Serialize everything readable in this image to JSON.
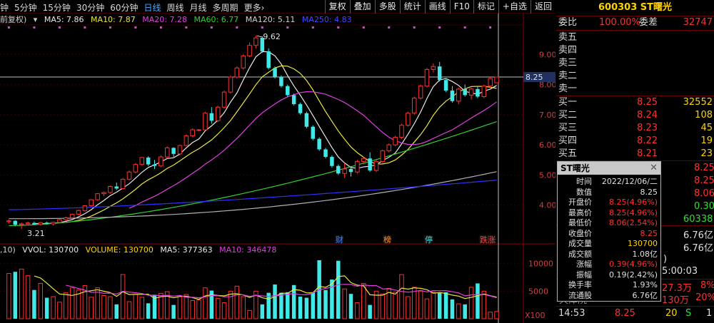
{
  "tabs": [
    "钟",
    "5分钟",
    "15分钟",
    "30分钟",
    "60分钟",
    "日线",
    "周线",
    "月线",
    "多周期",
    "更多›"
  ],
  "active_tab": 5,
  "toolbar": [
    "复权",
    "叠加",
    "多股",
    "统计",
    "画线",
    "F10",
    "标记",
    "+自选",
    "返回"
  ],
  "indicators": {
    "fq": "前复权)",
    "ma5": "MA5: 7.86",
    "ma10": "MA10: 7.87",
    "ma20": "MA20: 7.28",
    "ma60": "MA60: 6.77",
    "ma120": "MA120: 5.11",
    "ma250": "MA250: 4.83"
  },
  "vol_indicators": {
    "prefix": ",10)",
    "vvol": "VVOL: 130700",
    "volume": "VOLUME: 130700",
    "ma5": "MA5: 377363",
    "ma10": "MA10: 346478"
  },
  "price_axis": [
    "9.00",
    "8.00",
    "7.00",
    "6.00",
    "5.00",
    "4.00"
  ],
  "price_axis_values": [
    9,
    8,
    7,
    6,
    5,
    4
  ],
  "current_price_tag": "8.25",
  "current_price_value": 8.25,
  "high_label": "9.62",
  "high_value": 9.62,
  "low_label": "3.21",
  "low_value": 3.21,
  "volume_axis": [
    "10000",
    "5000"
  ],
  "volume_axis_values": [
    10000,
    5000
  ],
  "volume_unit": "X100",
  "markers": [
    "财",
    "榜",
    "停",
    "跌涨"
  ],
  "colors": {
    "up": "#ff3030",
    "down": "#40e8e8",
    "ma5": "#e8e8e8",
    "ma10": "#e8e840",
    "ma20": "#e040e0",
    "ma60": "#30d030",
    "ma120": "#b0b0b0",
    "ma250": "#3030ff",
    "highlight": "#ffd400"
  },
  "chart_data": {
    "type": "candlestick",
    "ohlc": [
      [
        3.45,
        3.52,
        3.4,
        3.48
      ],
      [
        3.48,
        3.5,
        3.3,
        3.35
      ],
      [
        3.35,
        3.42,
        3.21,
        3.38
      ],
      [
        3.38,
        3.45,
        3.32,
        3.41
      ],
      [
        3.41,
        3.45,
        3.34,
        3.36
      ],
      [
        3.36,
        3.44,
        3.32,
        3.42
      ],
      [
        3.42,
        3.45,
        3.35,
        3.38
      ],
      [
        3.38,
        3.45,
        3.33,
        3.43
      ],
      [
        3.43,
        3.55,
        3.4,
        3.52
      ],
      [
        3.52,
        3.62,
        3.48,
        3.58
      ],
      [
        3.58,
        3.72,
        3.55,
        3.7
      ],
      [
        3.7,
        3.85,
        3.66,
        3.82
      ],
      [
        3.82,
        4.0,
        3.78,
        3.98
      ],
      [
        3.98,
        4.2,
        3.95,
        4.18
      ],
      [
        4.18,
        4.4,
        4.15,
        4.38
      ],
      [
        4.38,
        4.45,
        4.3,
        4.42
      ],
      [
        4.42,
        4.65,
        4.38,
        4.62
      ],
      [
        4.62,
        4.75,
        4.5,
        4.55
      ],
      [
        4.55,
        4.9,
        4.52,
        4.86
      ],
      [
        4.86,
        5.15,
        4.82,
        5.1
      ],
      [
        5.1,
        5.4,
        5.05,
        5.35
      ],
      [
        5.35,
        5.6,
        5.3,
        5.58
      ],
      [
        5.58,
        5.62,
        5.3,
        5.35
      ],
      [
        5.35,
        5.5,
        5.2,
        5.3
      ],
      [
        5.3,
        5.65,
        5.25,
        5.6
      ],
      [
        5.6,
        5.95,
        5.55,
        5.9
      ],
      [
        5.9,
        5.92,
        5.6,
        5.7
      ],
      [
        5.7,
        6.0,
        5.65,
        5.98
      ],
      [
        5.98,
        6.35,
        5.95,
        6.3
      ],
      [
        6.3,
        6.55,
        6.25,
        6.5
      ],
      [
        6.5,
        6.52,
        6.45,
        6.5
      ],
      [
        6.5,
        7.1,
        6.48,
        7.05
      ],
      [
        7.05,
        7.25,
        6.7,
        6.8
      ],
      [
        6.8,
        7.3,
        6.75,
        7.25
      ],
      [
        7.25,
        7.8,
        7.2,
        7.75
      ],
      [
        7.75,
        8.3,
        7.7,
        8.25
      ],
      [
        8.25,
        8.6,
        8.2,
        8.55
      ],
      [
        8.55,
        9.0,
        8.5,
        8.95
      ],
      [
        8.95,
        9.4,
        8.9,
        9.3
      ],
      [
        9.3,
        9.62,
        9.2,
        9.55
      ],
      [
        9.55,
        9.6,
        9.05,
        9.1
      ],
      [
        9.1,
        9.2,
        8.5,
        8.55
      ],
      [
        8.55,
        8.6,
        8.2,
        8.25
      ],
      [
        8.25,
        8.3,
        7.9,
        7.95
      ],
      [
        7.95,
        8.0,
        7.6,
        7.65
      ],
      [
        7.65,
        7.7,
        7.3,
        7.35
      ],
      [
        7.35,
        7.4,
        7.0,
        7.05
      ],
      [
        7.05,
        7.1,
        6.55,
        6.6
      ],
      [
        6.6,
        6.65,
        6.15,
        6.2
      ],
      [
        6.2,
        6.25,
        5.8,
        5.85
      ],
      [
        5.85,
        5.9,
        5.55,
        5.6
      ],
      [
        5.6,
        5.65,
        5.25,
        5.3
      ],
      [
        5.3,
        5.35,
        5.0,
        5.05
      ],
      [
        5.05,
        5.4,
        4.9,
        5.2
      ],
      [
        5.2,
        5.3,
        4.95,
        5.1
      ],
      [
        5.1,
        5.5,
        5.05,
        5.45
      ],
      [
        5.45,
        5.6,
        5.35,
        5.55
      ],
      [
        5.55,
        5.75,
        5.1,
        5.15
      ],
      [
        5.15,
        5.5,
        5.1,
        5.45
      ],
      [
        5.45,
        5.85,
        5.4,
        5.8
      ],
      [
        5.8,
        6.05,
        5.75,
        6.0
      ],
      [
        6.0,
        6.3,
        5.95,
        6.25
      ],
      [
        6.25,
        6.7,
        6.2,
        6.65
      ],
      [
        6.65,
        7.1,
        6.6,
        7.05
      ],
      [
        7.05,
        7.6,
        7.0,
        7.55
      ],
      [
        7.55,
        8.0,
        7.5,
        7.95
      ],
      [
        7.95,
        8.55,
        7.9,
        8.5
      ],
      [
        8.5,
        8.7,
        8.4,
        8.6
      ],
      [
        8.6,
        8.75,
        8.1,
        8.15
      ],
      [
        8.15,
        8.2,
        7.75,
        7.8
      ],
      [
        7.8,
        7.95,
        7.4,
        7.45
      ],
      [
        7.45,
        7.9,
        7.35,
        7.85
      ],
      [
        7.85,
        8.0,
        7.6,
        7.65
      ],
      [
        7.65,
        7.9,
        7.5,
        7.85
      ],
      [
        7.85,
        7.95,
        7.55,
        7.6
      ],
      [
        7.6,
        8.0,
        7.55,
        7.95
      ],
      [
        7.95,
        8.25,
        7.9,
        8.2
      ],
      [
        8.06,
        8.25,
        8.06,
        8.25
      ]
    ],
    "volume": [
      8200,
      8500,
      9000,
      7800,
      5200,
      6400,
      3800,
      4000,
      3000,
      4700,
      5600,
      5200,
      6000,
      3900,
      5600,
      4200,
      4000,
      2600,
      8000,
      3100,
      4400,
      3900,
      2800,
      4200,
      4600,
      4900,
      2500,
      4000,
      4400,
      3300,
      3400,
      5600,
      5100,
      3700,
      2900,
      5000,
      5900,
      4000,
      1500,
      5000,
      2600,
      4700,
      6200,
      4700,
      4800,
      6100,
      4000,
      3800,
      4800,
      10600,
      5200,
      7100,
      10500,
      5400,
      4500,
      2900,
      6400,
      2500,
      5000,
      4500,
      5500,
      4800,
      8000,
      4000,
      5700,
      5000,
      3600,
      4800,
      4700,
      4800,
      3500,
      2700,
      2600,
      5700,
      6400,
      5000,
      1200,
      1300
    ],
    "xlabel": "",
    "ylabel": "",
    "ylim": [
      3.0,
      10.0
    ],
    "vol_ylim": [
      0,
      11500
    ]
  },
  "quote": {
    "title": "600303 ST曙光",
    "wb_label": "委比",
    "wb_value": "100.00%",
    "wc_label": "委差",
    "wc_value": "32747",
    "sells": [
      {
        "label": "卖五",
        "price": "",
        "vol": ""
      },
      {
        "label": "卖四",
        "price": "",
        "vol": ""
      },
      {
        "label": "卖三",
        "price": "",
        "vol": ""
      },
      {
        "label": "卖二",
        "price": "",
        "vol": ""
      },
      {
        "label": "卖一",
        "price": "",
        "vol": ""
      }
    ],
    "buys": [
      {
        "label": "买一",
        "price": "8.25",
        "vol": "32552"
      },
      {
        "label": "买二",
        "price": "8.24",
        "vol": "108"
      },
      {
        "label": "买三",
        "price": "8.23",
        "vol": "45"
      },
      {
        "label": "买四",
        "price": "8.22",
        "vol": "19"
      },
      {
        "label": "买五",
        "price": "8.21",
        "vol": "23"
      }
    ],
    "side_vals": [
      "8.25",
      "8.25",
      "8.06",
      "0.30",
      "60338",
      "6.76亿",
      "6.76亿"
    ],
    "time_val": "5:00:03",
    "vol_row1": "27.3万",
    "vol_row1_pct": "8%",
    "vol_row2": "130万",
    "vol_row2_pct": "20%",
    "partial_text": "天津院",
    "tick": {
      "time": "14:53",
      "price": "8.25",
      "vol": "20",
      "flag": "S",
      "num": "1"
    }
  },
  "popup": {
    "title": "ST曙光",
    "close": "✕",
    "rows": [
      {
        "label": "时间",
        "value": "2022/12/06/二",
        "color": "#e0e0e0"
      },
      {
        "label": "数值",
        "value": "8.25",
        "color": "#e0e0e0"
      },
      {
        "label": "开盘价",
        "value": "8.25(4.96%)",
        "color": "#ff3030"
      },
      {
        "label": "最高价",
        "value": "8.25(4.96%)",
        "color": "#ff3030"
      },
      {
        "label": "最低价",
        "value": "8.06(2.54%)",
        "color": "#ff3030"
      },
      {
        "label": "收盘价",
        "value": "8.25",
        "color": "#ff3030"
      },
      {
        "label": "成交量",
        "value": "130700",
        "color": "#ffd400"
      },
      {
        "label": "成交额",
        "value": "1.08亿",
        "color": "#e0e0e0"
      },
      {
        "label": "涨幅",
        "value": "0.39(4.96%)",
        "color": "#ff3030"
      },
      {
        "label": "振幅",
        "value": "0.19(2.42%)",
        "color": "#e0e0e0"
      },
      {
        "label": "换手率",
        "value": "1.93%",
        "color": "#e0e0e0"
      },
      {
        "label": "流通股",
        "value": "6.76亿",
        "color": "#e0e0e0"
      }
    ]
  }
}
